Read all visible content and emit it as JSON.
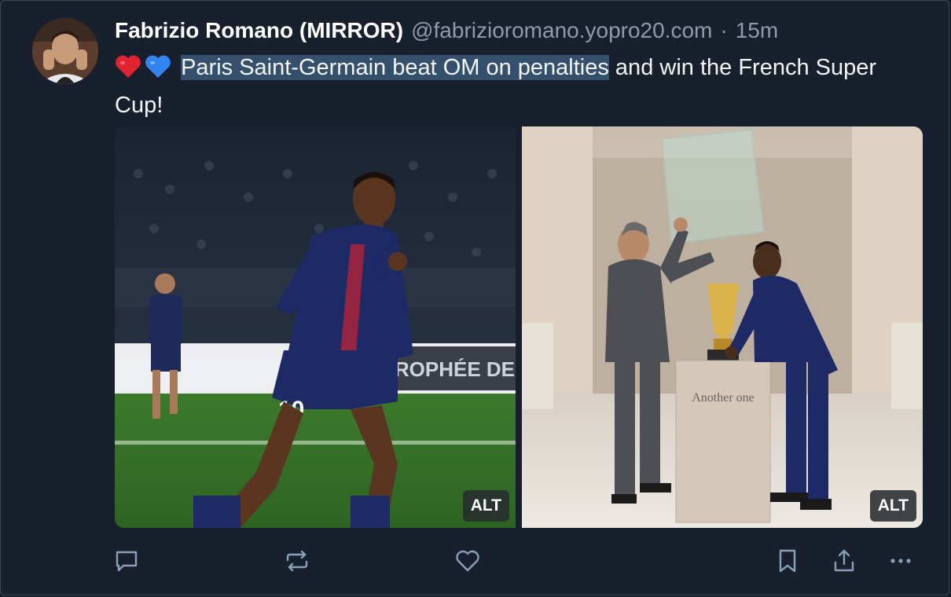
{
  "author": {
    "display_name": "Fabrizio Romano (MIRROR)",
    "handle": "@fabrizioromano.yopro20.com",
    "separator": "·",
    "time": "15m"
  },
  "post": {
    "emojis": [
      "red-heart",
      "blue-heart"
    ],
    "highlighted_text": "Paris Saint-Germain beat OM on penalties",
    "rest_text": " and win the French Super Cup!"
  },
  "media": [
    {
      "alt_label": "ALT",
      "board_text": "TROPHÉE DES CH",
      "shirt_number": "10"
    },
    {
      "alt_label": "ALT",
      "pedestal_text": "Another one"
    }
  ],
  "actions": [
    "reply-icon",
    "repost-icon",
    "like-icon",
    "bookmark-icon",
    "share-icon",
    "more-icon"
  ],
  "colors": {
    "background": "#17202c",
    "highlight": "#34506d",
    "muted": "#8f9bab",
    "icon": "#8aa0b8"
  }
}
